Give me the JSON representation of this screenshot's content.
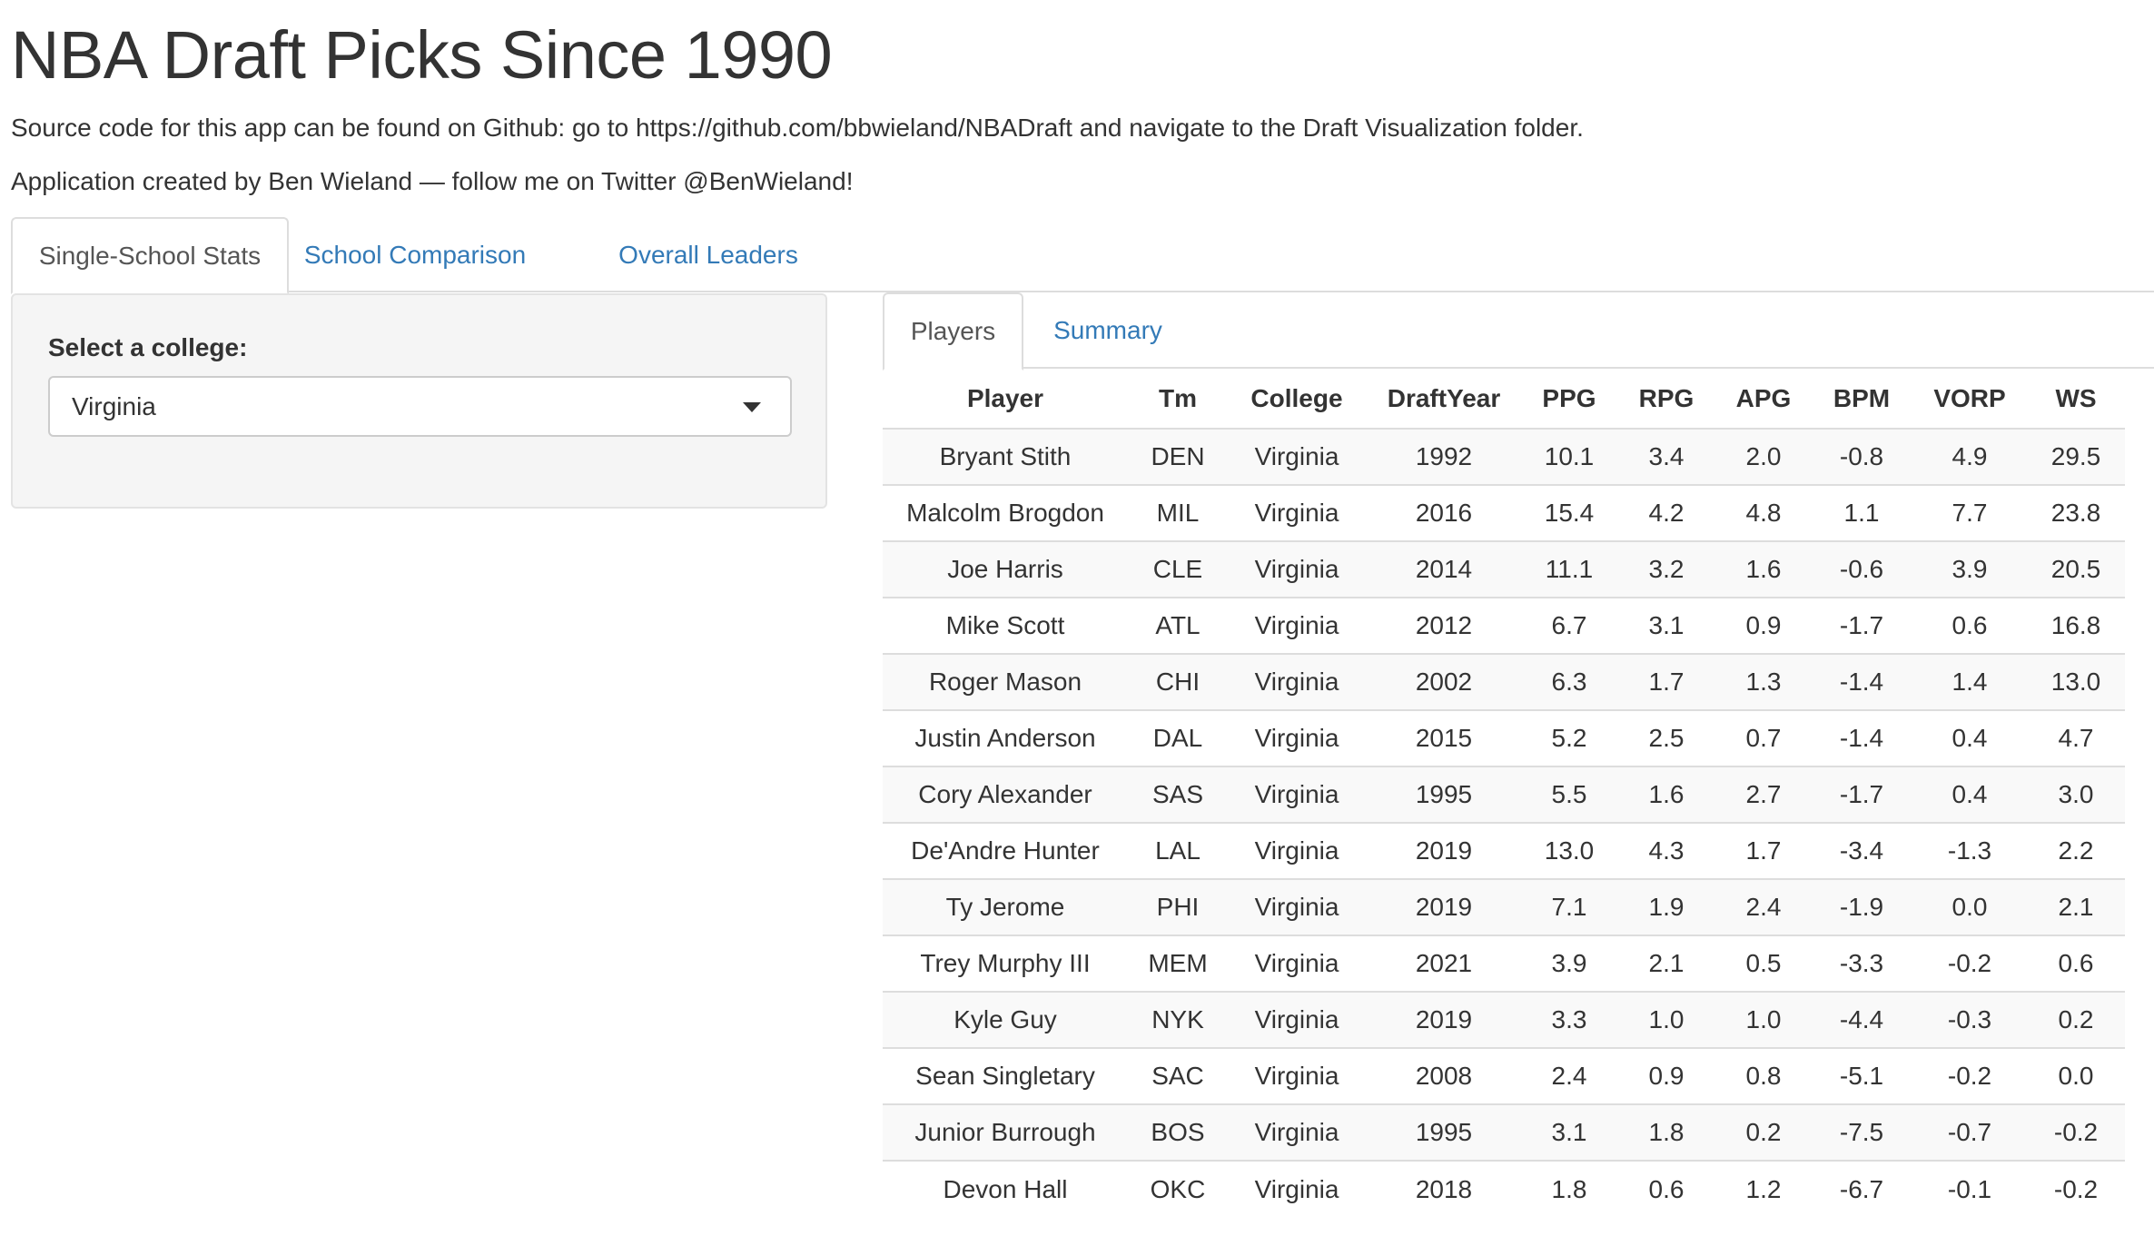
{
  "header": {
    "title": "NBA Draft Picks Since 1990",
    "source_line": "Source code for this app can be found on Github: go to https://github.com/bbwieland/NBADraft and navigate to the Draft Visualization folder.",
    "credit_line": "Application created by Ben Wieland — follow me on Twitter @BenWieland!"
  },
  "main_tabs": [
    {
      "label": "Single-School Stats",
      "active": true
    },
    {
      "label": "School Comparison",
      "active": false
    },
    {
      "label": "Overall Leaders",
      "active": false
    }
  ],
  "sidebar": {
    "label": "Select a college:",
    "selected_college": "Virginia"
  },
  "sub_tabs": [
    {
      "label": "Players",
      "active": true
    },
    {
      "label": "Summary",
      "active": false
    }
  ],
  "table": {
    "columns": [
      "Player",
      "Tm",
      "College",
      "DraftYear",
      "PPG",
      "RPG",
      "APG",
      "BPM",
      "VORP",
      "WS"
    ],
    "rows": [
      [
        "Bryant Stith",
        "DEN",
        "Virginia",
        "1992",
        "10.1",
        "3.4",
        "2.0",
        "-0.8",
        "4.9",
        "29.5"
      ],
      [
        "Malcolm Brogdon",
        "MIL",
        "Virginia",
        "2016",
        "15.4",
        "4.2",
        "4.8",
        "1.1",
        "7.7",
        "23.8"
      ],
      [
        "Joe Harris",
        "CLE",
        "Virginia",
        "2014",
        "11.1",
        "3.2",
        "1.6",
        "-0.6",
        "3.9",
        "20.5"
      ],
      [
        "Mike Scott",
        "ATL",
        "Virginia",
        "2012",
        "6.7",
        "3.1",
        "0.9",
        "-1.7",
        "0.6",
        "16.8"
      ],
      [
        "Roger Mason",
        "CHI",
        "Virginia",
        "2002",
        "6.3",
        "1.7",
        "1.3",
        "-1.4",
        "1.4",
        "13.0"
      ],
      [
        "Justin Anderson",
        "DAL",
        "Virginia",
        "2015",
        "5.2",
        "2.5",
        "0.7",
        "-1.4",
        "0.4",
        "4.7"
      ],
      [
        "Cory Alexander",
        "SAS",
        "Virginia",
        "1995",
        "5.5",
        "1.6",
        "2.7",
        "-1.7",
        "0.4",
        "3.0"
      ],
      [
        "De'Andre Hunter",
        "LAL",
        "Virginia",
        "2019",
        "13.0",
        "4.3",
        "1.7",
        "-3.4",
        "-1.3",
        "2.2"
      ],
      [
        "Ty Jerome",
        "PHI",
        "Virginia",
        "2019",
        "7.1",
        "1.9",
        "2.4",
        "-1.9",
        "0.0",
        "2.1"
      ],
      [
        "Trey Murphy III",
        "MEM",
        "Virginia",
        "2021",
        "3.9",
        "2.1",
        "0.5",
        "-3.3",
        "-0.2",
        "0.6"
      ],
      [
        "Kyle Guy",
        "NYK",
        "Virginia",
        "2019",
        "3.3",
        "1.0",
        "1.0",
        "-4.4",
        "-0.3",
        "0.2"
      ],
      [
        "Sean Singletary",
        "SAC",
        "Virginia",
        "2008",
        "2.4",
        "0.9",
        "0.8",
        "-5.1",
        "-0.2",
        "0.0"
      ],
      [
        "Junior Burrough",
        "BOS",
        "Virginia",
        "1995",
        "3.1",
        "1.8",
        "0.2",
        "-7.5",
        "-0.7",
        "-0.2"
      ],
      [
        "Devon Hall",
        "OKC",
        "Virginia",
        "2018",
        "1.8",
        "0.6",
        "1.2",
        "-6.7",
        "-0.1",
        "-0.2"
      ]
    ]
  }
}
